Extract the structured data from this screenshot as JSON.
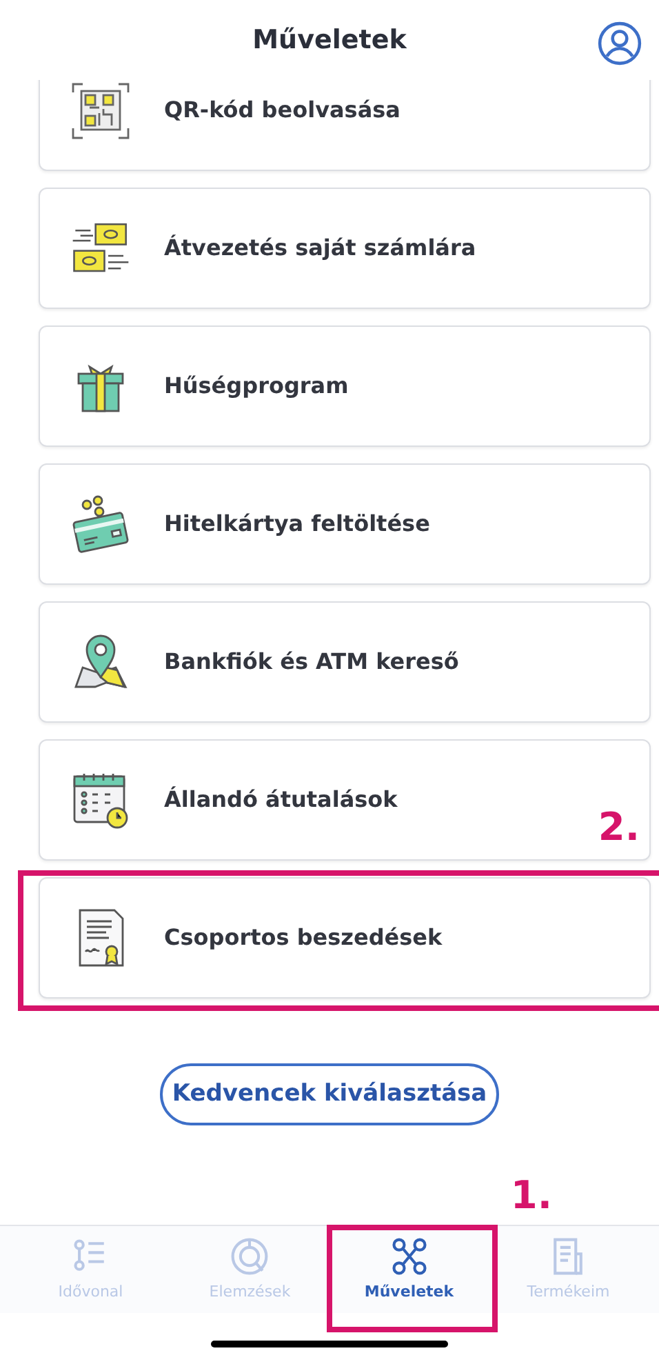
{
  "header": {
    "title": "Műveletek"
  },
  "items": [
    {
      "label": "QR-kód beolvasása",
      "kind": "qr"
    },
    {
      "label": "Átvezetés saját számlára",
      "kind": "transfer"
    },
    {
      "label": "Hűségprogram",
      "kind": "gift"
    },
    {
      "label": "Hitelkártya feltöltése",
      "kind": "card"
    },
    {
      "label": "Bankfiók és ATM kereső",
      "kind": "map"
    },
    {
      "label": "Állandó átutalások",
      "kind": "calendar"
    },
    {
      "label": "Csoportos beszedések",
      "kind": "certificate",
      "annotation": "2."
    }
  ],
  "favorites_button": "Kedvencek kiválasztása",
  "tabs": [
    {
      "label": "Idővonal",
      "kind": "timeline",
      "selected": false
    },
    {
      "label": "Elemzések",
      "kind": "chart",
      "selected": false
    },
    {
      "label": "Műveletek",
      "kind": "network",
      "selected": true,
      "annotation": "1."
    },
    {
      "label": "Termékeim",
      "kind": "document",
      "selected": false
    }
  ]
}
